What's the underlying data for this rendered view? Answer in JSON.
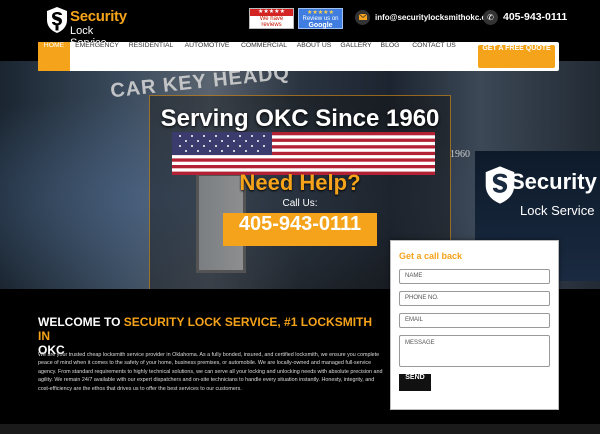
{
  "brand": {
    "title": "Security",
    "subtitle": "Lock Service"
  },
  "badges": {
    "yelp_top": "★★★★★",
    "yelp_text": "We have reviews",
    "google_top": "★★★★★",
    "google_text": "Review us on",
    "google_brand": "Google"
  },
  "contact": {
    "email": "info@securitylocksmithokc.com",
    "phone": "405-943-0111"
  },
  "nav": {
    "items": [
      "HOME",
      "EMERGENCY",
      "RESIDENTIAL",
      "AUTOMOTIVE",
      "COMMERCIAL",
      "ABOUT US",
      "GALLERY",
      "BLOG",
      "CONTACT US"
    ],
    "active": "HOME",
    "cta": "GET A FREE QUOTE"
  },
  "hero": {
    "bg_text_left": "CAR KEY HEADQ",
    "bg_year": "1960",
    "bg_sign_title": "Security",
    "bg_sign_sub": "Lock Service",
    "title": "Serving OKC Since 1960",
    "need_help": "Need Help?",
    "call_us": "Call Us:",
    "phone": "405-943-0111"
  },
  "callback": {
    "title": "Get a call back",
    "name_placeholder": "NAME",
    "phone_placeholder": "PHONE NO.",
    "email_placeholder": "EMAIL",
    "message_placeholder": "MESSAGE",
    "send": "SEND"
  },
  "welcome": {
    "title_plain": "WELCOME TO ",
    "title_highlight": "SECURITY LOCK SERVICE, #1 LOCKSMITH IN",
    "title_end": "OKC",
    "body": "We are your trusted cheap locksmith service provider in Oklahoma. As a fully bonded, insured, and certified locksmith, we ensure you complete peace of mind when it comes to the safety of your home, business premises, or automobile. We are locally-owned and managed full-service agency. From standard requirements to highly technical solutions, we can serve all your locking and unlocking needs with absolute precision and agility. We remain 24/7 available with our expert dispatchers and on-site technicians to handle every situation instantly. Honesty, integrity, and cost-efficiency are the ethos that drives us to offer the best services to our customers."
  },
  "colors": {
    "accent": "#f5a31a",
    "background": "#000000",
    "nav_bg": "#ffffff"
  },
  "icons": {
    "email": "envelope-icon",
    "phone": "phone-icon",
    "logo": "shield-lock-icon"
  }
}
